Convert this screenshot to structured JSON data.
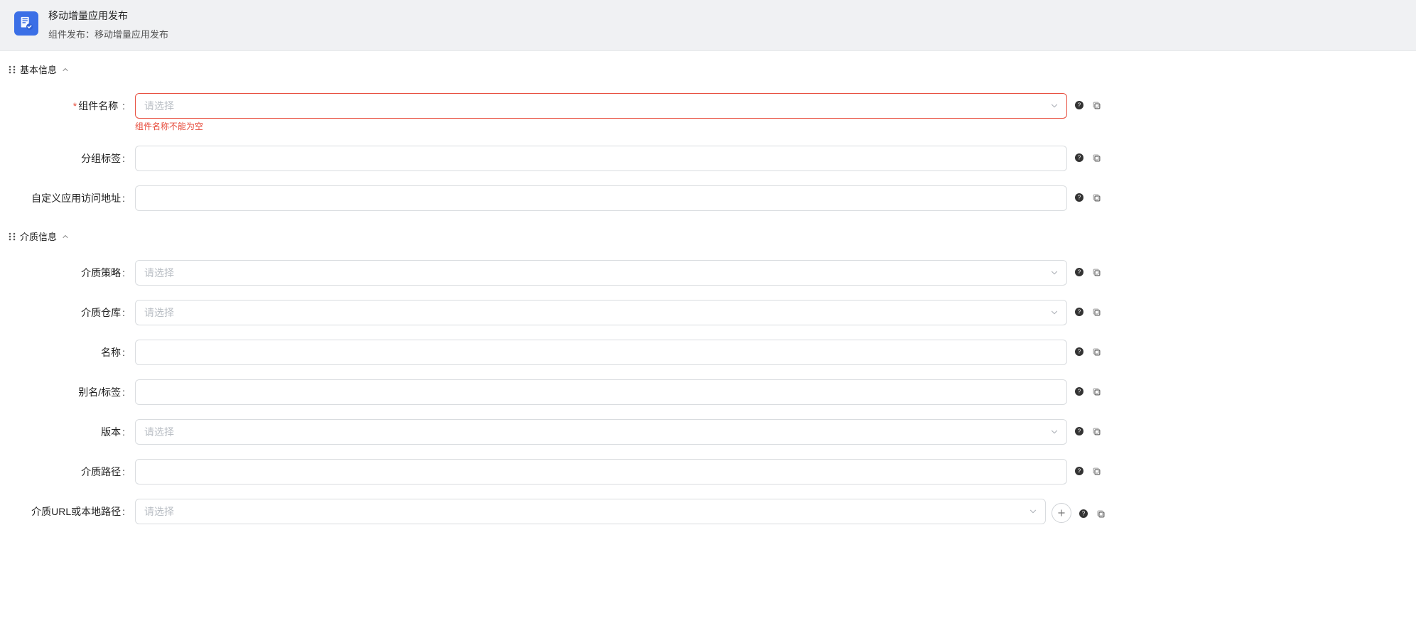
{
  "header": {
    "title": "移动增量应用发布",
    "subtitle_prefix": "组件发布：",
    "subtitle_value": "移动增量应用发布"
  },
  "sections": {
    "basic": {
      "title": "基本信息"
    },
    "media": {
      "title": "介质信息"
    }
  },
  "placeholders": {
    "select": "请选择"
  },
  "fields": {
    "component_name": {
      "label": "组件名称",
      "required": true,
      "error": "组件名称不能为空"
    },
    "group_tag": {
      "label": "分组标签"
    },
    "custom_url": {
      "label": "自定义应用访问地址"
    },
    "media_strategy": {
      "label": "介质策略"
    },
    "media_repo": {
      "label": "介质仓库"
    },
    "name": {
      "label": "名称"
    },
    "alias": {
      "label": "别名/标签"
    },
    "version": {
      "label": "版本"
    },
    "media_path": {
      "label": "介质路径"
    },
    "media_url": {
      "label": "介质URL或本地路径"
    }
  },
  "icons": {
    "help": "help-icon",
    "copy": "copy-icon",
    "plus": "plus-icon"
  }
}
